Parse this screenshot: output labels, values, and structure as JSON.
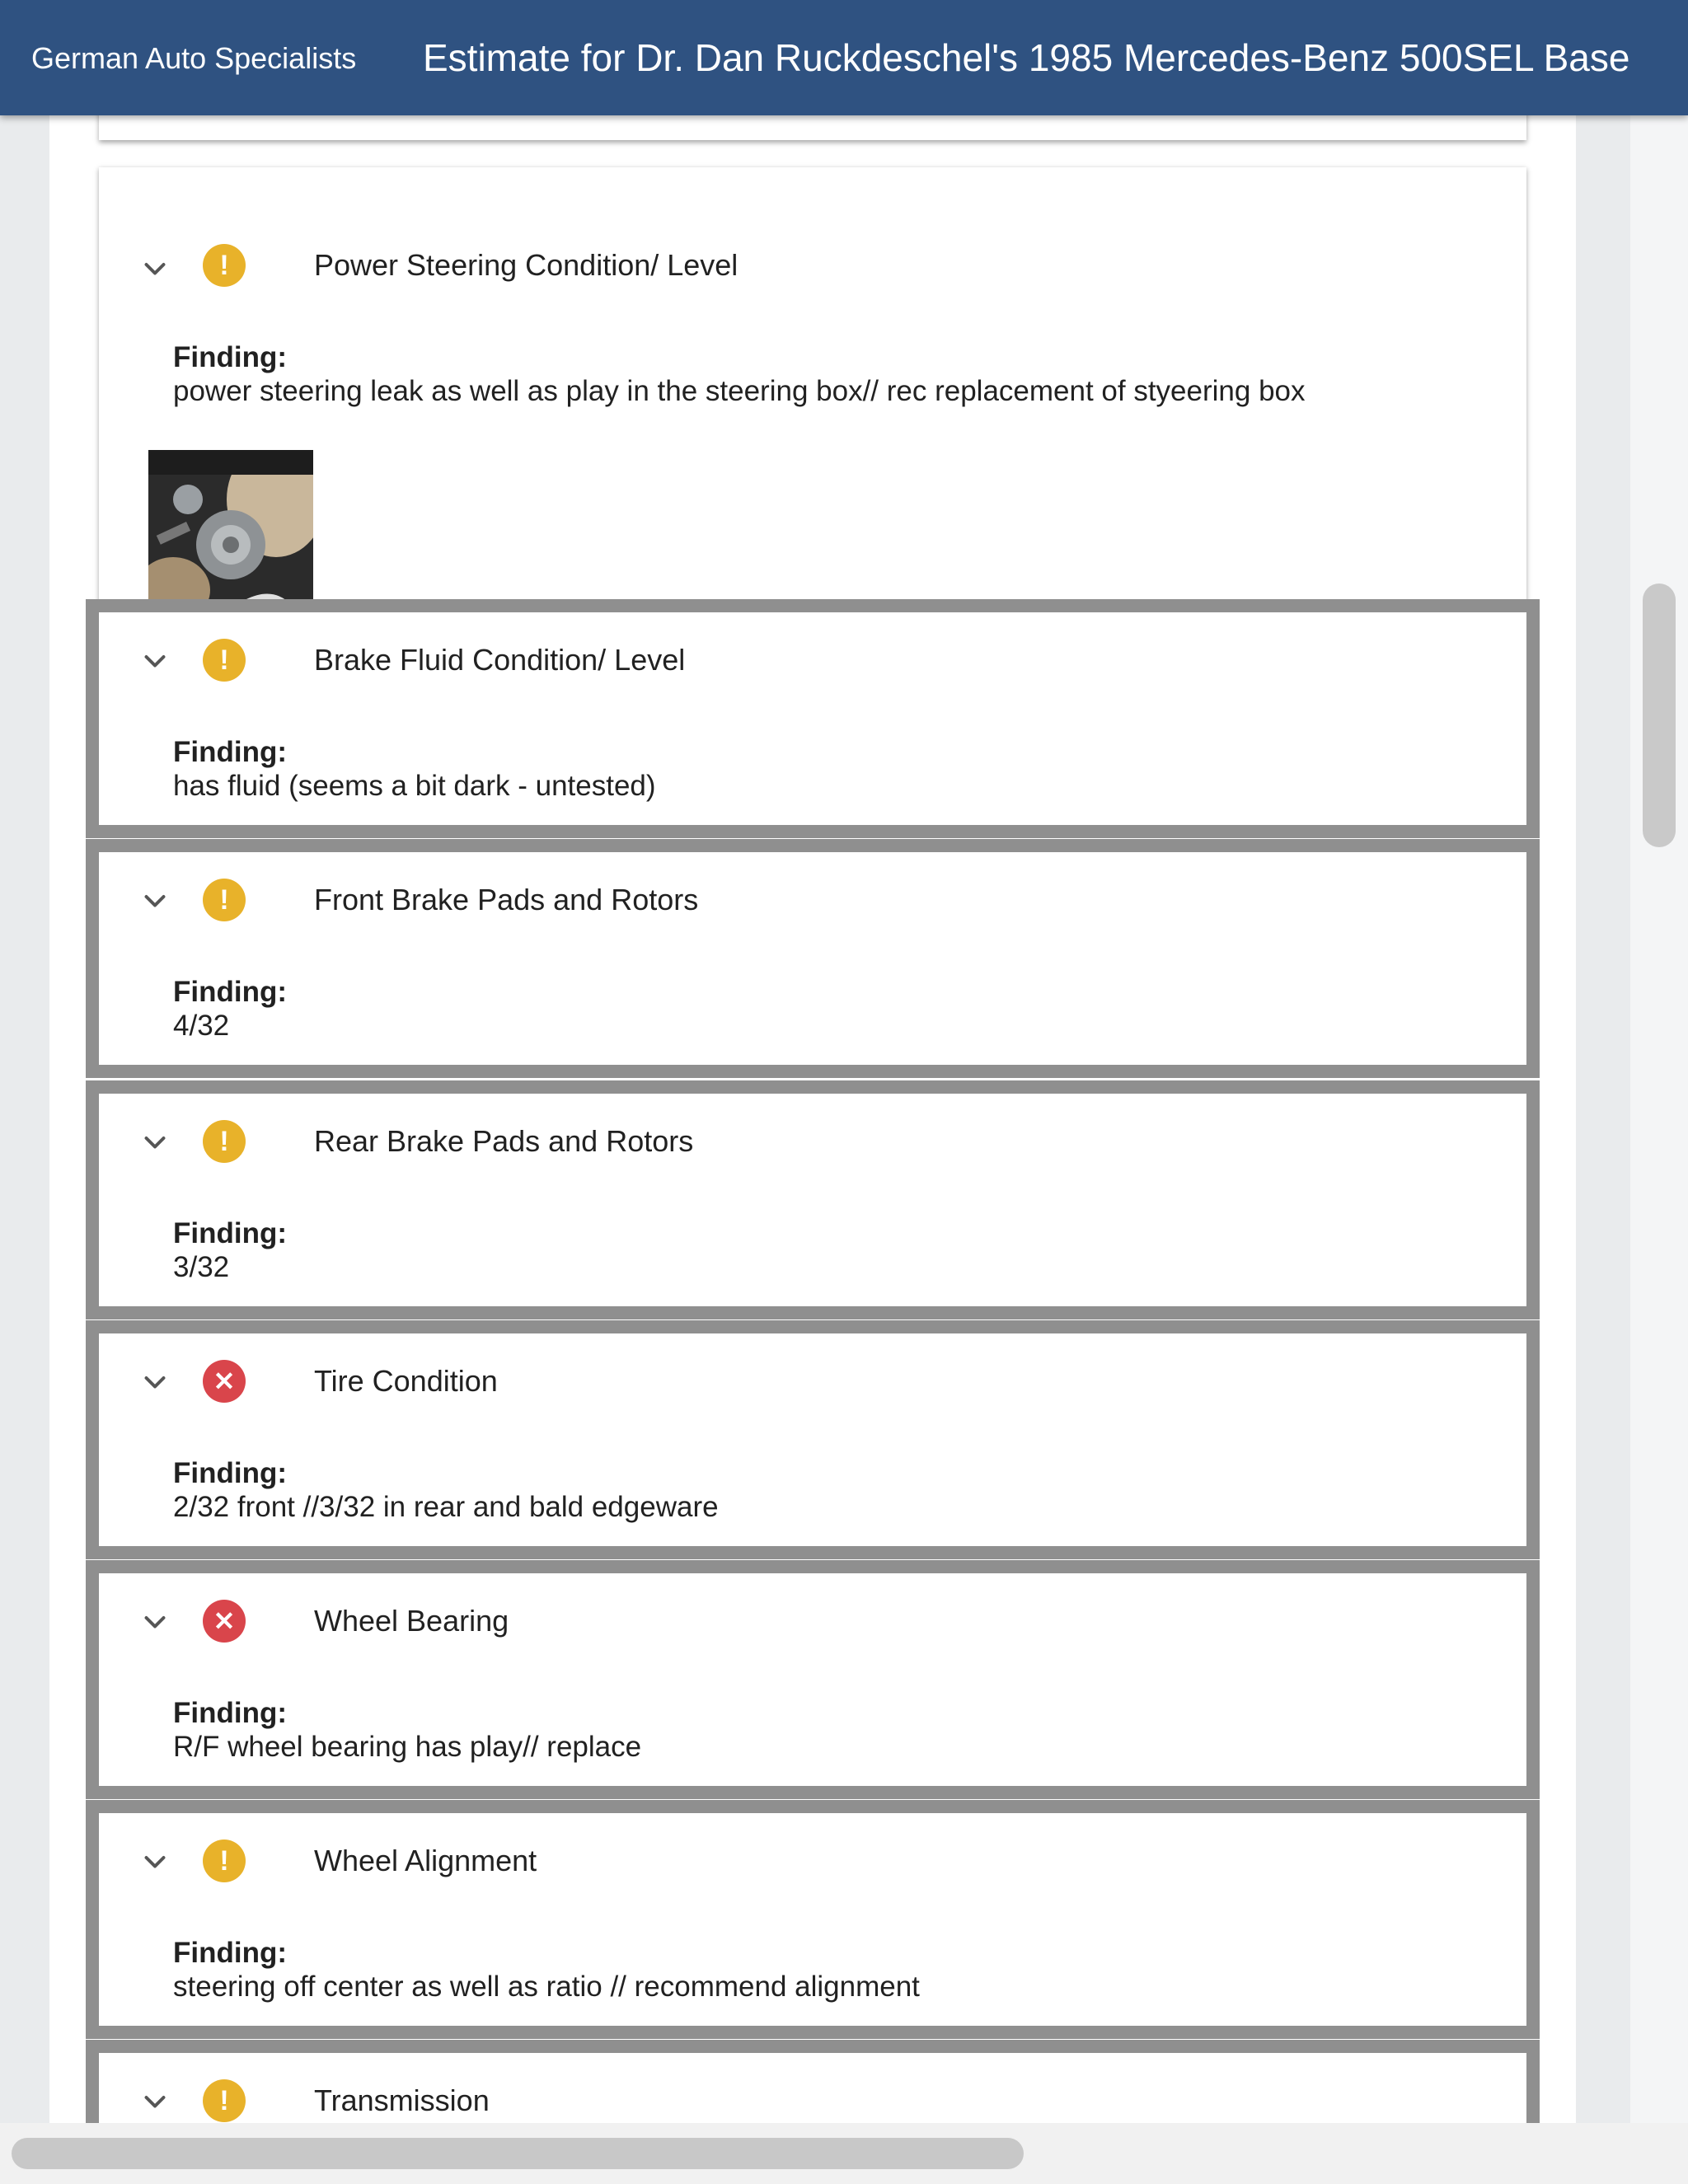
{
  "header": {
    "brand": "German Auto Specialists",
    "title": "Estimate for Dr. Dan Ruckdeschel's 1985 Mercedes-Benz 500SEL Base"
  },
  "finding_label": "Finding:",
  "colors": {
    "header": "#2f5281",
    "warning": "#e8b22a",
    "critical": "#d9454b"
  },
  "items": [
    {
      "title": "Power Steering Condition/ Level",
      "status": "warning",
      "status_icon": "exclamation-icon",
      "finding": "power steering leak as well as play in the steering box// rec replacement of styeering box",
      "has_photo": true
    },
    {
      "title": "Brake Fluid Condition/ Level",
      "status": "warning",
      "status_icon": "exclamation-icon",
      "finding": "has fluid (seems a bit dark - untested)"
    },
    {
      "title": "Front Brake Pads and Rotors",
      "status": "warning",
      "status_icon": "exclamation-icon",
      "finding": "4/32"
    },
    {
      "title": "Rear Brake Pads and Rotors",
      "status": "warning",
      "status_icon": "exclamation-icon",
      "finding": "3/32"
    },
    {
      "title": "Tire Condition",
      "status": "critical",
      "status_icon": "x-icon",
      "finding": "2/32 front //3/32 in rear and bald edgeware"
    },
    {
      "title": "Wheel Bearing",
      "status": "critical",
      "status_icon": "x-icon",
      "finding": "R/F wheel bearing has play// replace"
    },
    {
      "title": "Wheel Alignment",
      "status": "warning",
      "status_icon": "exclamation-icon",
      "finding": "steering off center as well as ratio // recommend alignment"
    },
    {
      "title": "Transmission",
      "status": "warning",
      "status_icon": "exclamation-icon"
    }
  ]
}
